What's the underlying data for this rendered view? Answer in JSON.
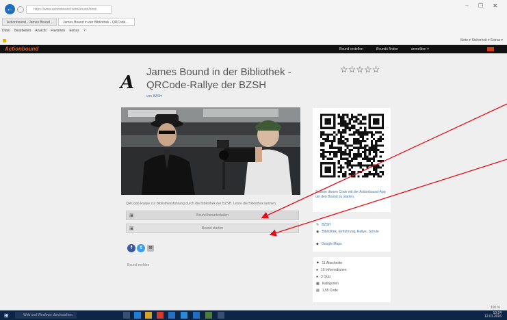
{
  "browser": {
    "address": "https://www.actionbound.com/bound/bzsh",
    "tabs": [
      {
        "label": "Actionbound - James Bound ..."
      },
      {
        "label": "James Bound in der Bibliothek - QRCode..."
      }
    ],
    "menu": [
      "Datei",
      "Bearbeiten",
      "Ansicht",
      "Favoriten",
      "Extras",
      "?"
    ],
    "command_bar": "Seite ▾  Sicherheit ▾  Extras ▾",
    "window_controls": "– ❐ ✕"
  },
  "site": {
    "logo": "Actionbound",
    "nav": [
      "Bound erstellen",
      "Bounds finden",
      "anmelden ▾"
    ]
  },
  "bound": {
    "logo_glyph": "A",
    "title": "James Bound in der Bibliothek - QRCode-Rallye der BZSH",
    "byline": "von BZSH",
    "rating": "☆☆☆☆☆",
    "description": "QRCode-Rallye zur Bibliotheksführung durch die Bibliothek der BZSH. Lerne die Bibliothek kennen.",
    "actions": [
      {
        "icon": "▣",
        "label": "Bound herunterladen"
      },
      {
        "icon": "▣",
        "label": "Bound starten"
      }
    ],
    "share": {
      "facebook": "f",
      "twitter": "t",
      "mail": "✉"
    },
    "report": "Bound melden"
  },
  "sidebar": {
    "qr_caption": "Scanne diesen Code mit der Actionbound-App um den Bound zu starten.",
    "links": [
      {
        "icon": "✎",
        "label": "BZSH"
      },
      {
        "icon": "◉",
        "label": "Bibliothek, Einführung, Rallye, Schule"
      },
      {
        "icon": "◆",
        "label": "Google Maps"
      }
    ],
    "stats": [
      {
        "icon": "⚑",
        "label": "11 Abschnitte"
      },
      {
        "icon": "●",
        "label": "10 Informationen"
      },
      {
        "icon": "●",
        "label": "3 Quiz"
      },
      {
        "icon": "▦",
        "label": "Kategorien"
      },
      {
        "icon": "▤",
        "label": "1,55 Code"
      }
    ]
  },
  "taskbar": {
    "search_placeholder": "Web und Windows durchsuchen",
    "time": "10:24",
    "date": "12.01.2016"
  },
  "status": {
    "zoom": "100 %"
  },
  "colors": {
    "site_nav_bg": "#111111",
    "brand_orange": "#e05a1c",
    "link_blue": "#3a76b6",
    "annotation_red": "#e0101a",
    "taskbar_bg": "#0d2545"
  }
}
